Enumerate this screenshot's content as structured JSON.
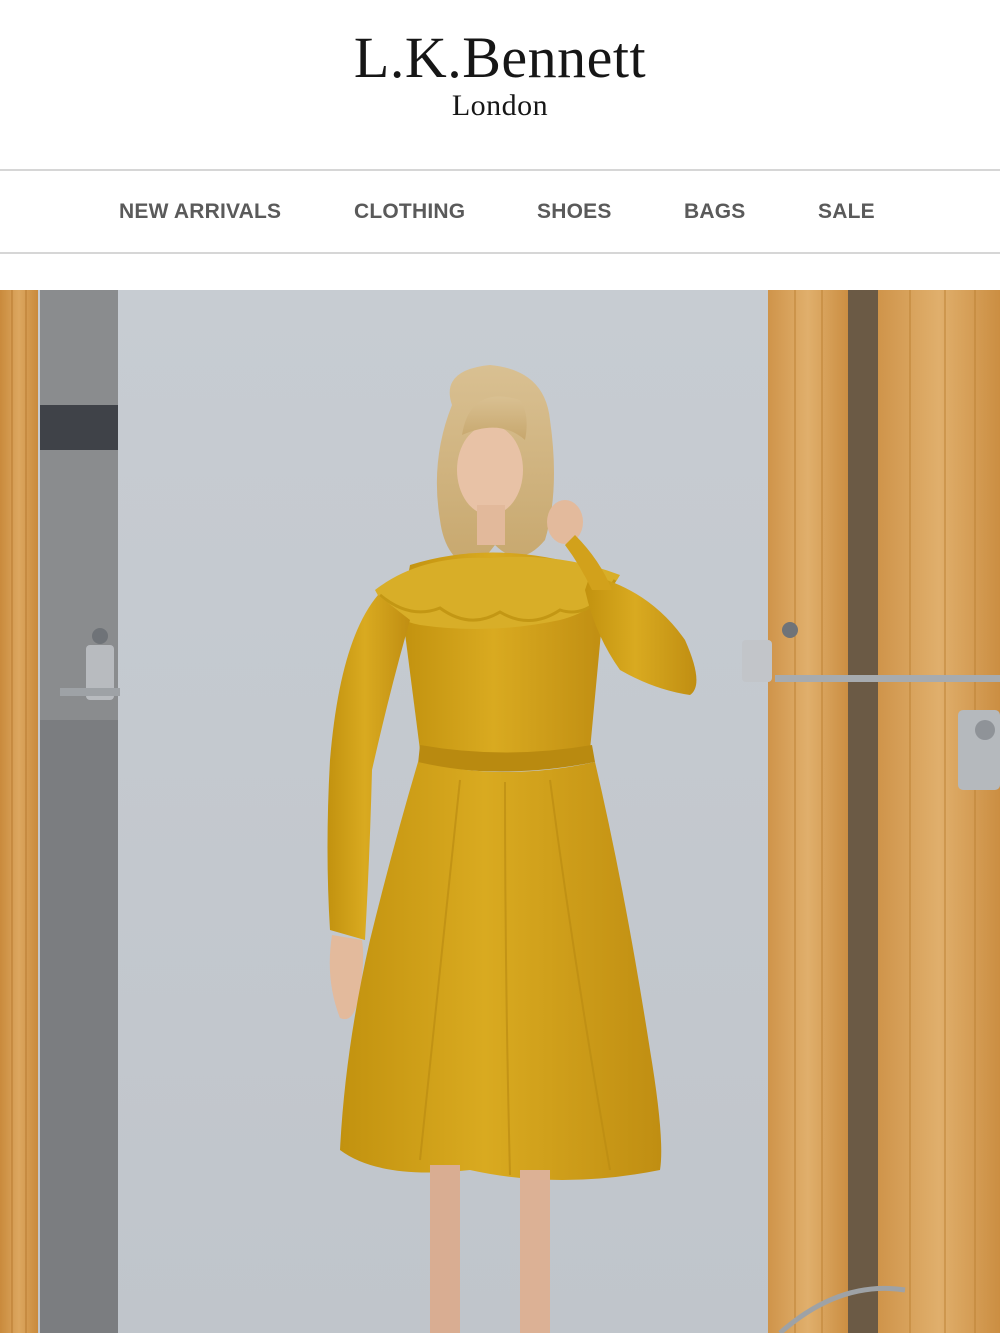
{
  "brand": {
    "name": "L.K.Bennett",
    "location": "London"
  },
  "nav": {
    "items": [
      {
        "label": "NEW ARRIVALS"
      },
      {
        "label": "CLOTHING"
      },
      {
        "label": "SHOES"
      },
      {
        "label": "BAGS"
      },
      {
        "label": "SALE"
      }
    ]
  },
  "hero": {
    "image": "model-in-mustard-yellow-lace-trim-midi-dress",
    "colors": {
      "dress": "#d4a418",
      "backdrop": "#c4c9cf",
      "wood": "#d29a4a"
    }
  }
}
